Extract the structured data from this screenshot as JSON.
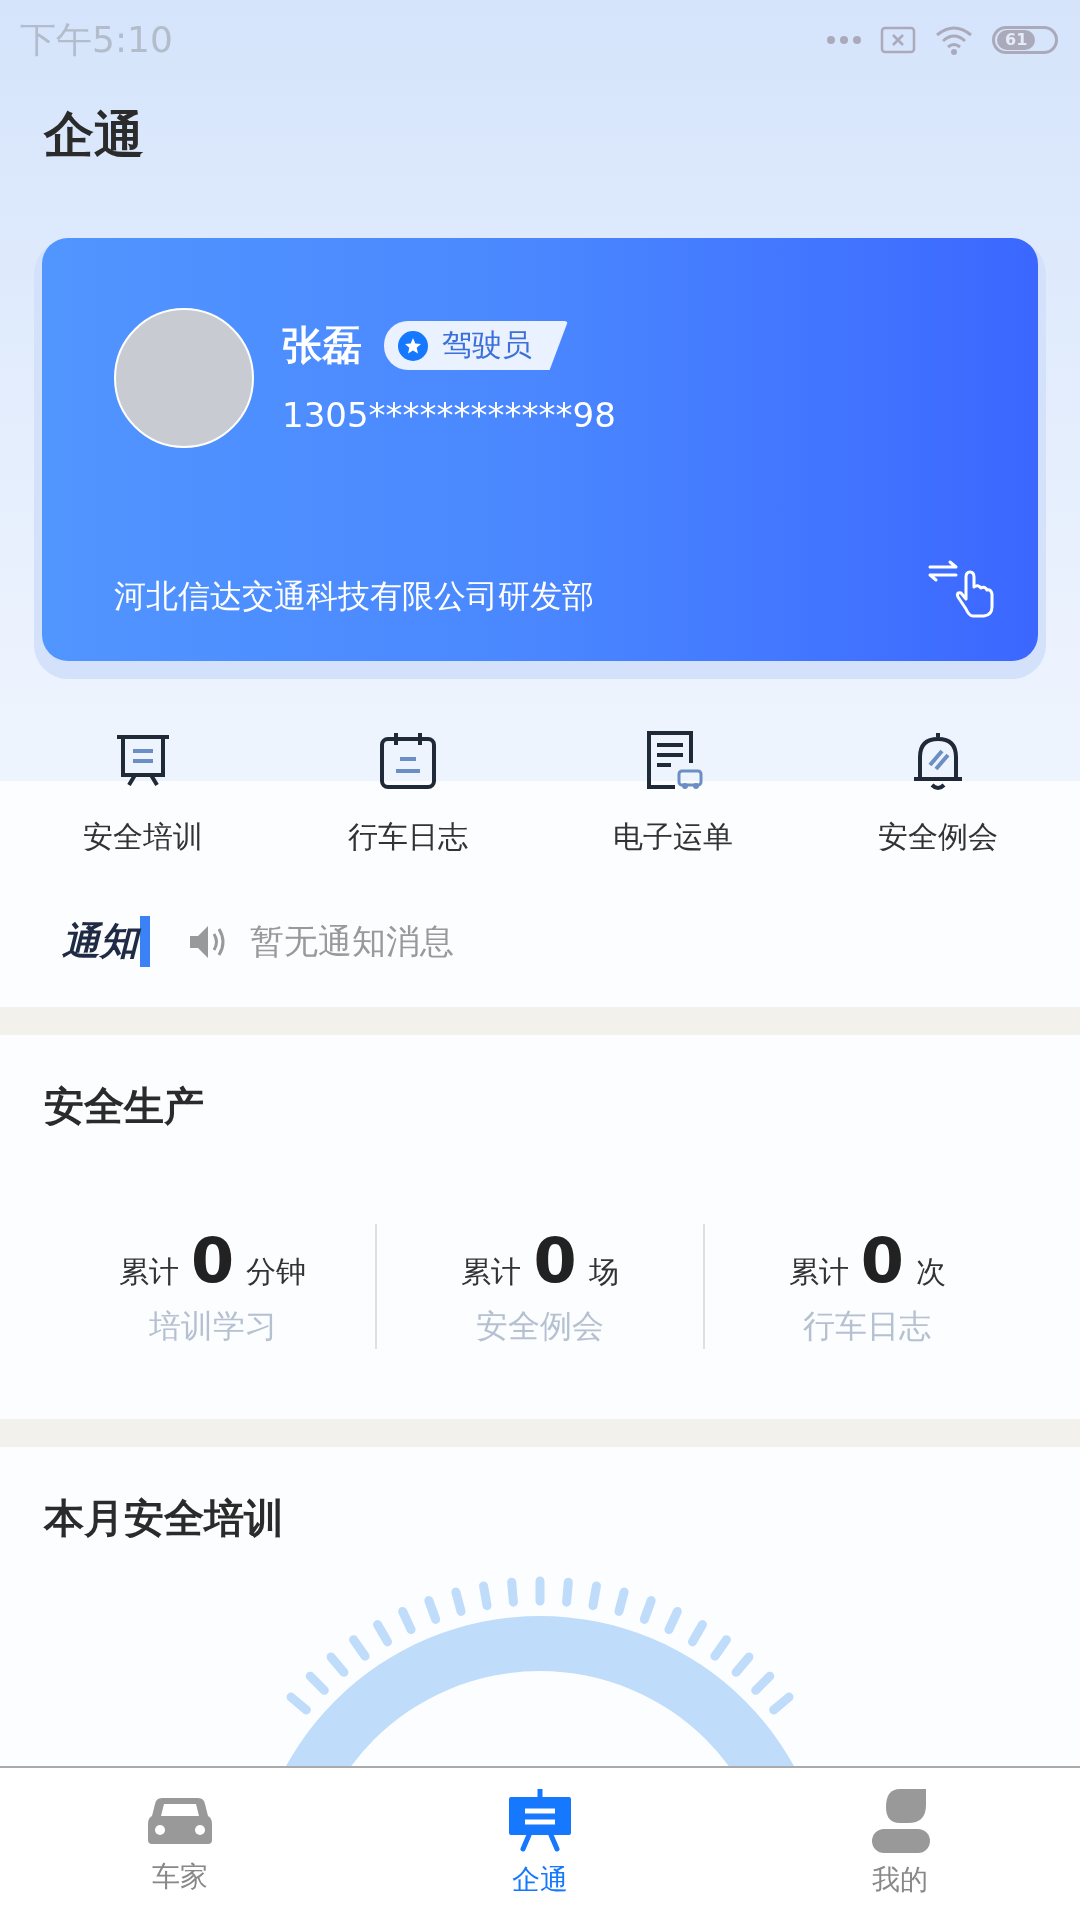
{
  "status_bar": {
    "time": "下午5:10",
    "battery": "61"
  },
  "header": {
    "title": "企通"
  },
  "profile": {
    "name": "张磊",
    "role": "驾驶员",
    "phone": "1305************98",
    "company": "河北信达交通科技有限公司研发部"
  },
  "shortcuts": [
    {
      "label": "安全培训",
      "kind": "board"
    },
    {
      "label": "行车日志",
      "kind": "calendar"
    },
    {
      "label": "电子运单",
      "kind": "waybill"
    },
    {
      "label": "安全例会",
      "kind": "bell"
    }
  ],
  "notice": {
    "logo": "通知",
    "text": "暂无通知消息"
  },
  "safety": {
    "title": "安全生产",
    "stats": [
      {
        "prefix": "累计",
        "value": "0",
        "unit": "分钟",
        "label": "培训学习"
      },
      {
        "prefix": "累计",
        "value": "0",
        "unit": "场",
        "label": "安全例会"
      },
      {
        "prefix": "累计",
        "value": "0",
        "unit": "次",
        "label": "行车日志"
      }
    ]
  },
  "monthly": {
    "title": "本月安全培训"
  },
  "tabs": [
    {
      "label": "车家",
      "kind": "car",
      "selected": false
    },
    {
      "label": "企通",
      "kind": "board",
      "selected": true
    },
    {
      "label": "我的",
      "kind": "person",
      "selected": false
    }
  ]
}
